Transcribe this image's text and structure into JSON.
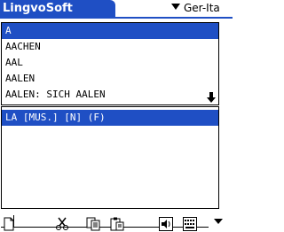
{
  "app": {
    "title": "LingvoSoft",
    "language_pair": "Ger-Ita"
  },
  "word_list": {
    "items": [
      {
        "text": "A",
        "selected": true
      },
      {
        "text": "AACHEN",
        "selected": false
      },
      {
        "text": "AAL",
        "selected": false
      },
      {
        "text": "AALEN",
        "selected": false
      },
      {
        "text": "AALEN: SICH AALEN",
        "selected": false
      }
    ],
    "scroll_icon": "arrow-down-icon"
  },
  "translation": {
    "text": "LA [MUS.] [N] (F)"
  },
  "input": {
    "value": "",
    "history_icon": "triangle-down-icon"
  },
  "toolbar": {
    "icons": [
      "new-document-icon",
      "cut-icon",
      "copy-icon",
      "paste-icon",
      "speaker-icon",
      "keyboard-icon"
    ]
  },
  "colors": {
    "accent": "#1f4fc4",
    "background": "#ffffff",
    "text": "#000000"
  }
}
